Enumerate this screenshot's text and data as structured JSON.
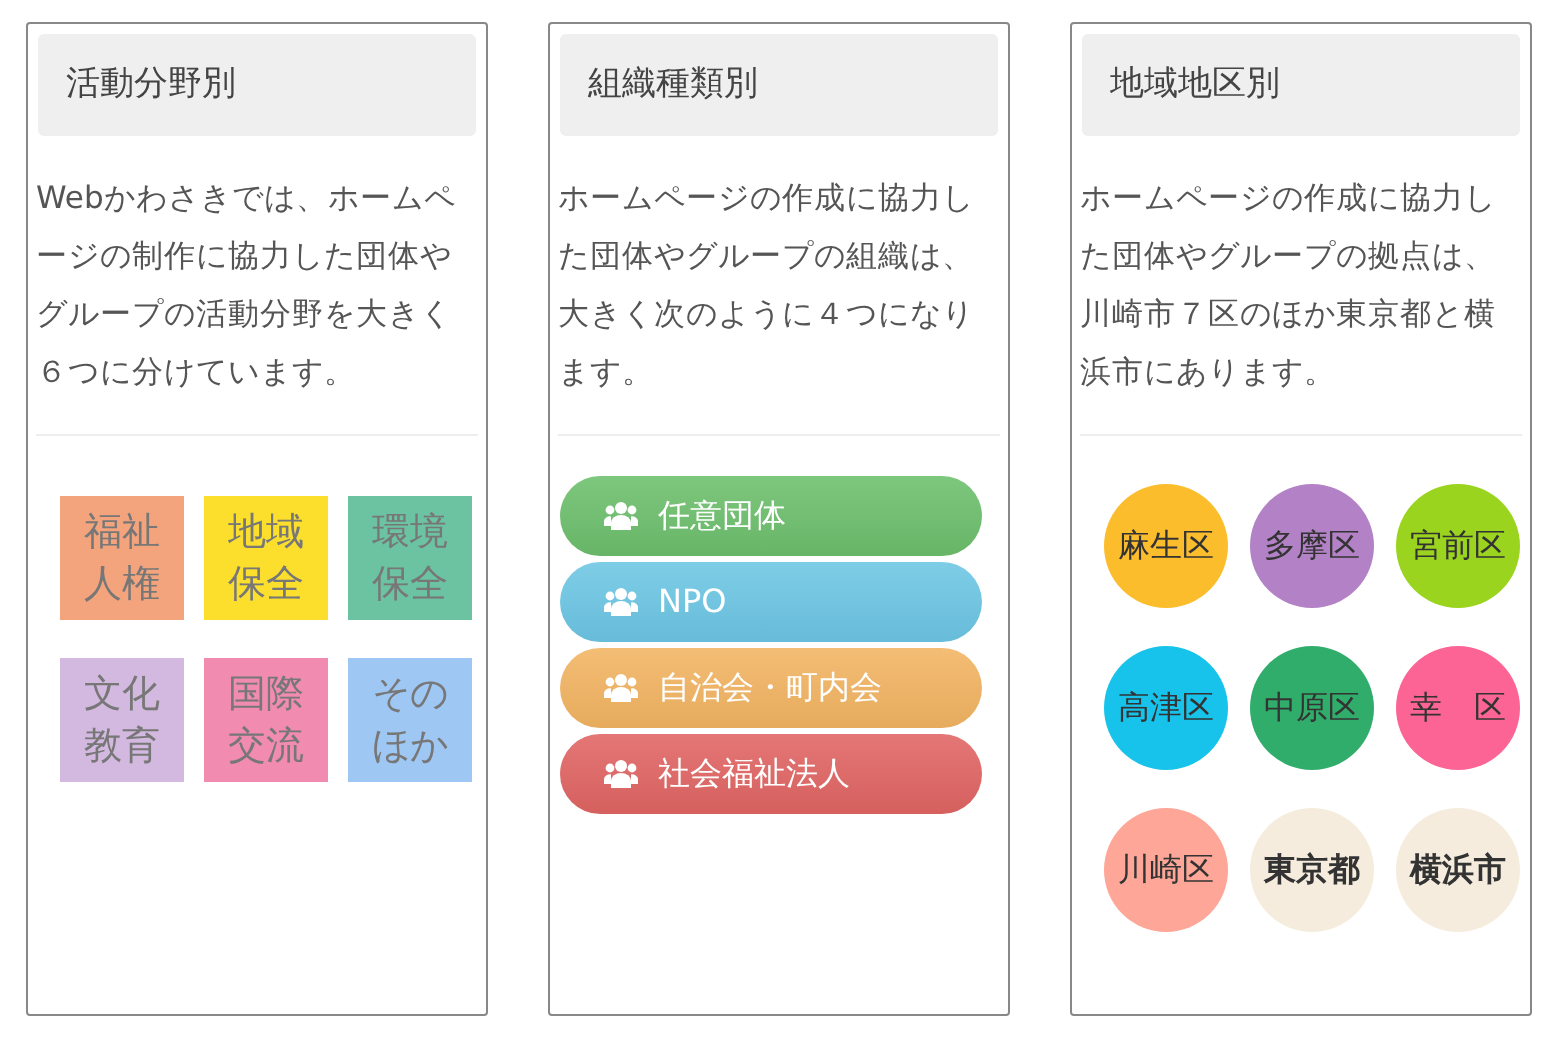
{
  "panels": [
    {
      "kind": "tiles",
      "title": "活動分野別",
      "description": "Webかわさきでは、ホームページの制作に協力した団体やグループの活動分野を大きく６つに分けています。",
      "items": [
        {
          "label": "福祉人権",
          "color": "#f4a47c"
        },
        {
          "label": "地域保全",
          "color": "#fbdf2c"
        },
        {
          "label": "環境保全",
          "color": "#6cc3a2"
        },
        {
          "label": "文化教育",
          "color": "#d3b9e0"
        },
        {
          "label": "国際交流",
          "color": "#f18bb0"
        },
        {
          "label": "そのほか",
          "color": "#9fc7f3"
        }
      ]
    },
    {
      "kind": "pills",
      "title": "組織種類別",
      "description": "ホームページの作成に協力した団体やグループの組織は、大きく次のように４つになります。",
      "items": [
        {
          "label": "任意団体",
          "color": "#6cbf6c"
        },
        {
          "label": "NPO",
          "color": "#6cc6e4"
        },
        {
          "label": "自治会・町内会",
          "color": "#f2b462"
        },
        {
          "label": "社会福祉法人",
          "color": "#e06563"
        }
      ]
    },
    {
      "kind": "circles",
      "title": "地域地区別",
      "description": "ホームページの作成に協力した団体やグループの拠点は、川崎市７区のほか東京都と横浜市にあります。",
      "items": [
        {
          "label": "麻生区",
          "color": "#fcbd2c",
          "bold": false
        },
        {
          "label": "多摩区",
          "color": "#b381c6",
          "bold": false
        },
        {
          "label": "宮前区",
          "color": "#9bd41e",
          "bold": false
        },
        {
          "label": "高津区",
          "color": "#17c3ea",
          "bold": false
        },
        {
          "label": "中原区",
          "color": "#31ad6b",
          "bold": false
        },
        {
          "label": "幸　区",
          "color": "#fc6496",
          "bold": false
        },
        {
          "label": "川崎区",
          "color": "#fea697",
          "bold": false
        },
        {
          "label": "東京都",
          "color": "#f5ecdd",
          "bold": true
        },
        {
          "label": "横浜市",
          "color": "#f5ecdd",
          "bold": true
        }
      ]
    }
  ]
}
